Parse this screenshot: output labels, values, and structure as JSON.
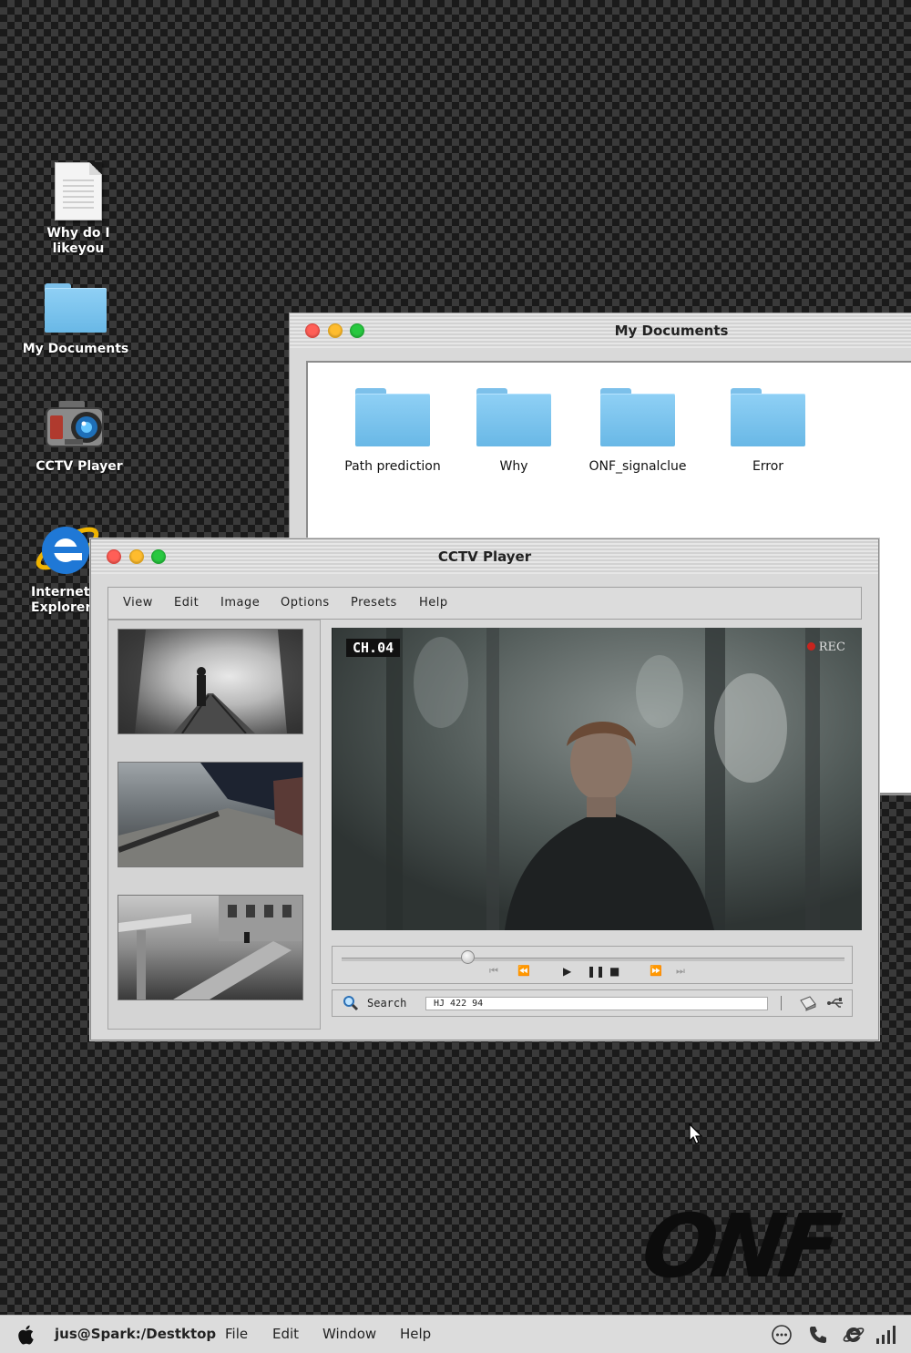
{
  "desktop": {
    "icons": [
      {
        "label": "Why do I likeyou",
        "icon": "document-icon"
      },
      {
        "label": "My Documents",
        "icon": "folder-icon"
      },
      {
        "label": "CCTV Player",
        "icon": "camera-icon"
      },
      {
        "label": "Internet Explorer",
        "icon": "internet-explorer-icon"
      }
    ]
  },
  "documents_window": {
    "title": "My Documents",
    "folders": [
      {
        "name": "Path prediction"
      },
      {
        "name": "Why"
      },
      {
        "name": "ONF_signalclue"
      },
      {
        "name": "Error"
      }
    ]
  },
  "cctv_window": {
    "title": "CCTV Player",
    "menu": [
      "View",
      "Edit",
      "Image",
      "Options",
      "Presets",
      "Help"
    ],
    "player": {
      "channel": "CH.04",
      "rec_label": "REC",
      "progress": 0.25
    },
    "search": {
      "label": "Search",
      "value": "HJ 422 94"
    }
  },
  "taskbar": {
    "path": "jus@Spark:/Destktop",
    "menu": [
      "File",
      "Edit",
      "Window",
      "Help"
    ]
  },
  "logo": "ONF",
  "colors": {
    "folder_blue": "#7cc3ee",
    "light_red": "#ff5f57",
    "light_yellow": "#febc2e",
    "light_green": "#28c840",
    "rec_red": "#c8241e"
  }
}
